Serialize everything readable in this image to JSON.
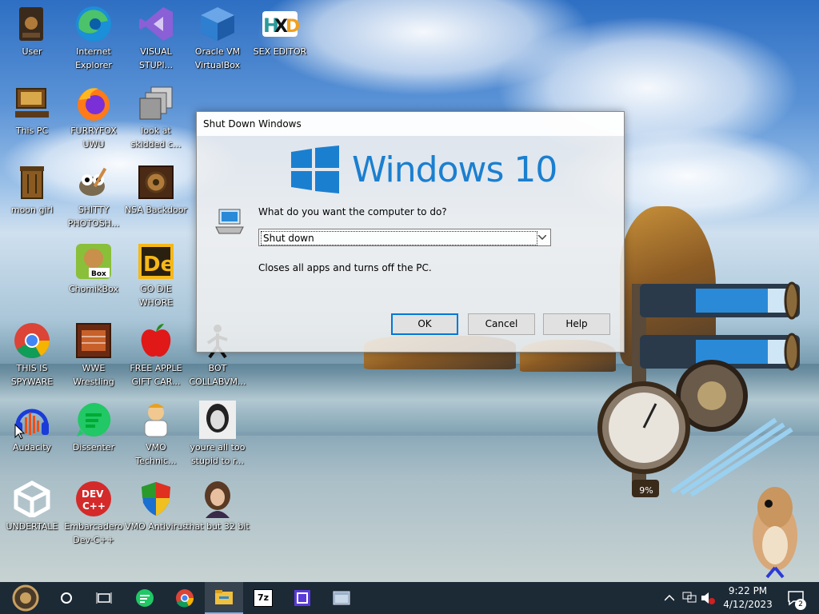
{
  "desktop": {
    "icons": [
      {
        "label": "User",
        "icon": "user-folder-icon"
      },
      {
        "label": "Internet Explorer",
        "icon": "edge-browser-icon"
      },
      {
        "label": "VISUAL STUPI...",
        "icon": "visual-studio-icon"
      },
      {
        "label": "Oracle VM VirtualBox",
        "icon": "virtualbox-icon"
      },
      {
        "label": "SEX EDITOR",
        "icon": "hex-editor-icon"
      },
      {
        "label": "This PC",
        "icon": "this-pc-icon"
      },
      {
        "label": "FURRYFOX UWU",
        "icon": "firefox-icon"
      },
      {
        "label": "look at skidded c...",
        "icon": "stacked-windows-icon"
      },
      {
        "label": "moon girl",
        "icon": "recycle-bin-icon"
      },
      {
        "label": "SHITTY PHOTOSH...",
        "icon": "gimp-icon"
      },
      {
        "label": "NSA Backdoor",
        "icon": "steampunk-box-icon"
      },
      {
        "label": "ChomikBox",
        "icon": "chomikbox-icon"
      },
      {
        "label": "GO DIE WHORE",
        "icon": "de-app-icon"
      },
      {
        "label": "THIS IS SPYWARE",
        "icon": "chrome-icon"
      },
      {
        "label": "WWE Wrestling",
        "icon": "wrestling-app-icon"
      },
      {
        "label": "FREE APPLE GIFT CAR...",
        "icon": "apple-icon"
      },
      {
        "label": "BOT COLLABVM...",
        "icon": "bot-app-icon"
      },
      {
        "label": "Audacity",
        "icon": "audacity-icon"
      },
      {
        "label": "Dissenter",
        "icon": "dissenter-icon"
      },
      {
        "label": "VMO Technic...",
        "icon": "technician-icon"
      },
      {
        "label": "youre all too stupid to r...",
        "icon": "portrait-icon"
      },
      {
        "label": "UNDERTALE",
        "icon": "unity-icon"
      },
      {
        "label": "Embarcadero Dev-C++",
        "icon": "devcpp-icon"
      },
      {
        "label": "VMO Antivirus",
        "icon": "shield-antivirus-icon"
      },
      {
        "label": "that but 32 bit",
        "icon": "portrait-woman-icon"
      }
    ]
  },
  "widget": {
    "gauge_label": "9%"
  },
  "dialog": {
    "title": "Shut Down Windows",
    "logo_text": "Windows 10",
    "question": "What do you want the computer to do?",
    "selected_option": "Shut down",
    "description": "Closes all apps and turns off the PC.",
    "ok_label": "OK",
    "cancel_label": "Cancel",
    "help_label": "Help"
  },
  "taskbar": {
    "pinned": [
      "start-icon",
      "cortana-icon",
      "task-view-icon",
      "dissenter-icon",
      "chrome-icon",
      "file-explorer-icon",
      "7zip-icon",
      "app-icon",
      "cmd-icon"
    ],
    "seven_zip": "7z",
    "time": "9:22 PM",
    "date": "4/12/2023",
    "notification_count": "2"
  },
  "colors": {
    "accent": "#0078d7",
    "windows_blue": "#1b7fd0",
    "taskbar": "#1c2a36"
  }
}
